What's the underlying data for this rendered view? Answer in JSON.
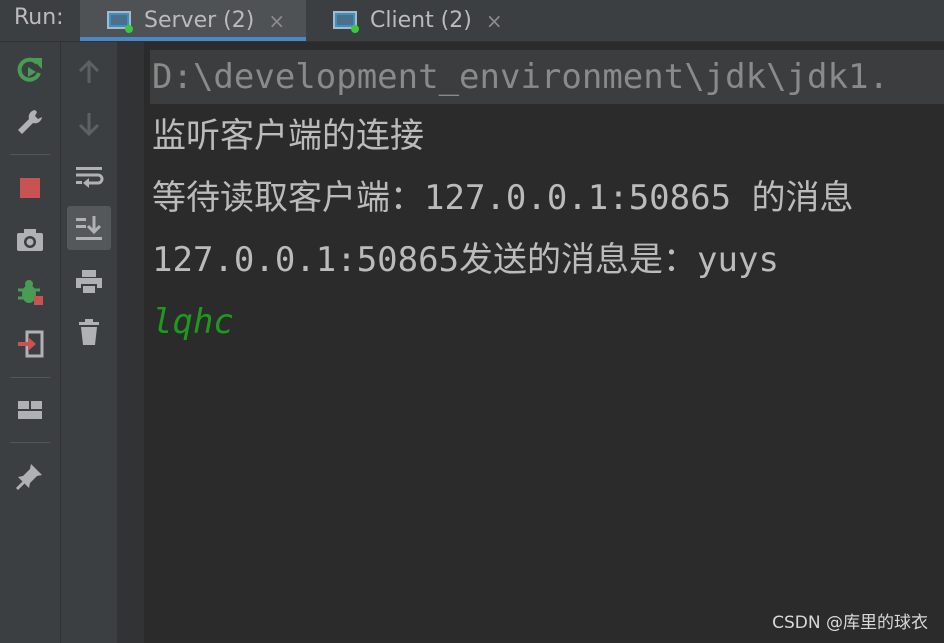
{
  "run_panel": {
    "label": "Run:",
    "tabs": [
      {
        "label": "Server (2)",
        "close": "×",
        "active": true
      },
      {
        "label": "Client (2)",
        "close": "×",
        "active": false
      }
    ]
  },
  "console": {
    "command_line": "D:\\development_environment\\jdk\\jdk1.",
    "lines": [
      "监听客户端的连接",
      "等待读取客户端：127.0.0.1:50865 的消息",
      "127.0.0.1:50865发送的消息是：yuys"
    ],
    "user_input": "lqhc"
  },
  "colors": {
    "background": "#2b2b2b",
    "toolbar": "#3c3f41",
    "output_text": "#bbbbbb",
    "input_text": "#1d9a1d",
    "rerun_icon": "#499c54",
    "stop_icon": "#c75450",
    "tab_underline": "#4a88c7"
  },
  "watermark": "CSDN @库里的球衣"
}
